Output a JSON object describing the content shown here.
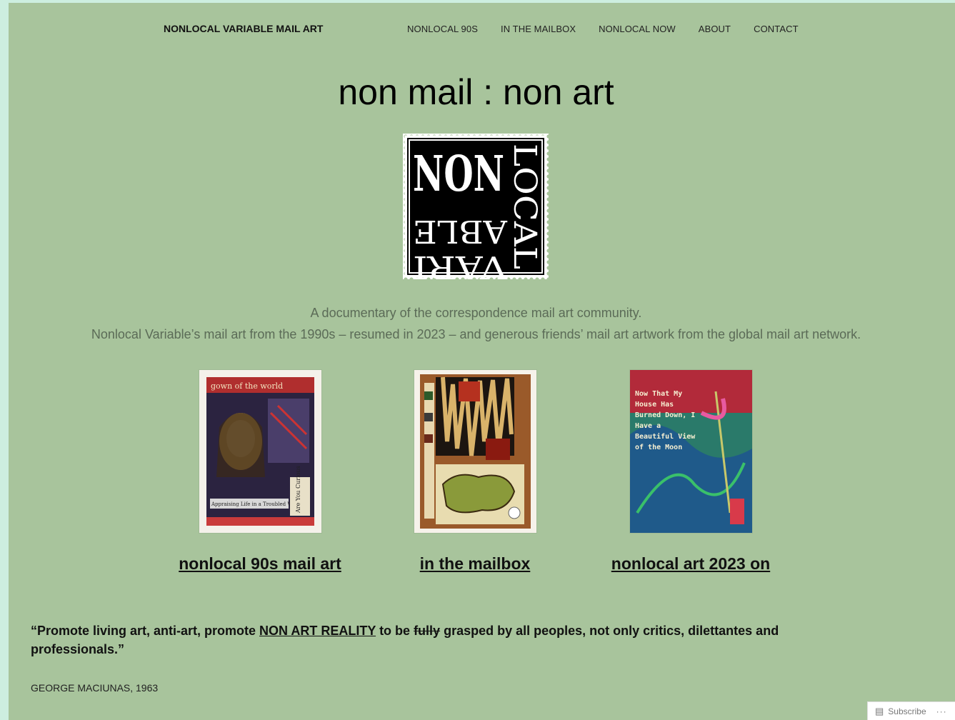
{
  "header": {
    "site_title": "NONLOCAL VARIABLE MAIL ART",
    "nav": [
      "NONLOCAL 90S",
      "IN THE MAILBOX",
      "NONLOCAL NOW",
      "ABOUT",
      "CONTACT"
    ]
  },
  "main": {
    "headline": "non mail : non art",
    "logo": {
      "top_text": "NON",
      "side_text": "LOCAL",
      "bottom_text": "VARIABLE"
    },
    "tagline_1": "A documentary of the correspondence mail art community.",
    "tagline_2": "Nonlocal Variable’s mail art from the 1990s – resumed in 2023 – and generous friends’ mail art artwork from the global mail art network.",
    "cards": [
      {
        "link": "nonlocal 90s mail art",
        "thumb_text": "gown of the world",
        "thumb_caption": "Are You Curious",
        "thumb_strip": "Appraising Life in a Troubled World"
      },
      {
        "link": "in the mailbox"
      },
      {
        "link": "nonlocal art 2023 on",
        "thumb_text_lines": [
          "Now That My",
          "House Has",
          "Burned Down, I",
          "Have a",
          "Beautiful View",
          "of the Moon"
        ]
      }
    ],
    "quote": {
      "part1": "“Promote living art, anti-art, promote ",
      "underlined": "NON ART REALITY",
      "part2": " to be ",
      "struck": "fully",
      "part3": " grasped by all peoples, not only critics, dilettantes and professionals.”"
    },
    "attribution": "GEORGE MACIUNAS, 1963"
  },
  "footer": {
    "subscribe_label": "Subscribe",
    "more_label": "···"
  }
}
